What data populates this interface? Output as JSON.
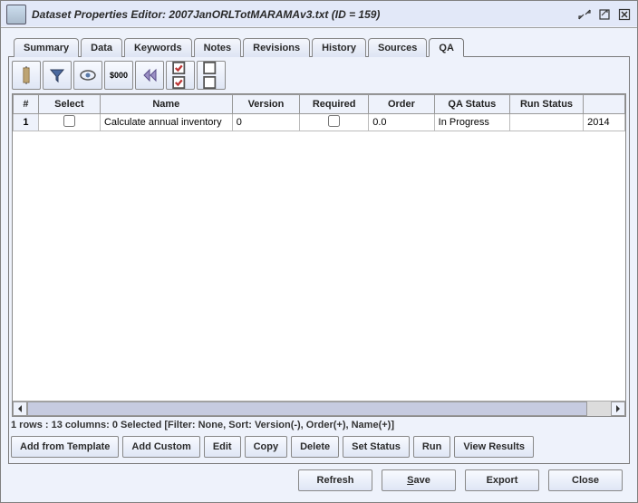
{
  "window": {
    "title": "Dataset Properties Editor: 2007JanORLTotMARAMAv3.txt (ID = 159)"
  },
  "tabs": [
    "Summary",
    "Data",
    "Keywords",
    "Notes",
    "Revisions",
    "History",
    "Sources",
    "QA"
  ],
  "active_tab": "QA",
  "toolbar_icons": {
    "columns": "columns-icon",
    "filter": "filter-icon",
    "view": "eye-icon",
    "price": "$000",
    "first": "first-icon",
    "checklist": "checklist-icon",
    "uncheck": "uncheck-icon"
  },
  "table": {
    "headers": [
      "#",
      "Select",
      "Name",
      "Version",
      "Required",
      "Order",
      "QA Status",
      "Run Status",
      ""
    ],
    "rows": [
      {
        "idx": "1",
        "select": false,
        "name": "Calculate annual inventory",
        "version": "0",
        "required": false,
        "order": "0.0",
        "qa_status": "In Progress",
        "run_status": "",
        "extra": "2014"
      }
    ]
  },
  "status_line": "1 rows : 13 columns: 0 Selected [Filter: None, Sort: Version(-), Order(+), Name(+)]",
  "action_buttons": [
    "Add from Template",
    "Add Custom",
    "Edit",
    "Copy",
    "Delete",
    "Set Status",
    "Run",
    "View Results"
  ],
  "bottom_buttons": {
    "refresh": "Refresh",
    "save_letter": "S",
    "save_rest": "ave",
    "export": "Export",
    "close": "Close"
  }
}
